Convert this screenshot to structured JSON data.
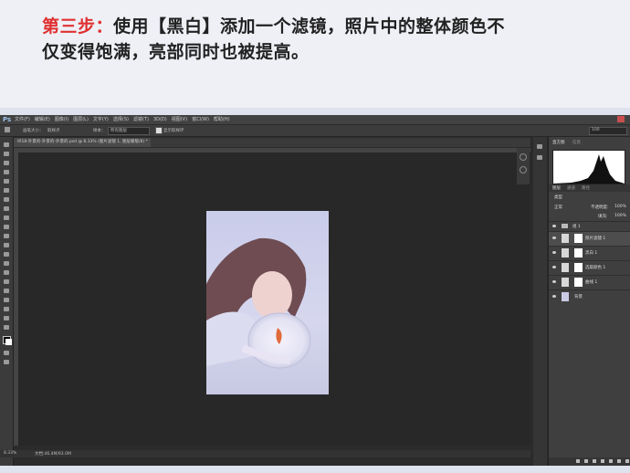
{
  "banner": {
    "step_label": "第三步：",
    "line1_rest": "使用【黑白】添加一个滤镜，照片中的整体颜色不",
    "line2": "仅变得饱满，亮部同时也被提高。"
  },
  "app": {
    "logo": "Ps",
    "menu": [
      "文件(F)",
      "编辑(E)",
      "图像(I)",
      "图层(L)",
      "文字(Y)",
      "选择(S)",
      "滤镜(T)",
      "3D(D)",
      "视图(V)",
      "窗口(W)",
      "帮助(H)"
    ],
    "accent_color": "#9dc4ef"
  },
  "options": {
    "size_label": "画笔大小：",
    "sample_label": "取样点",
    "sample_label2": "样本：",
    "sample_value": "所有图层",
    "show_ring": "显示取样环",
    "zoom_value": "100"
  },
  "document": {
    "tab_title": "IR18-外景的-外景的-外景的.psd @ 8.33% (图片滤镜 1, 图层蒙版/8) *"
  },
  "status": {
    "zoom": "8.33%",
    "doc_size": "文档:46.4M/93.0M"
  },
  "panels": {
    "histogram_tab": "直方图",
    "info_tab": "信息",
    "layers_tab": "图层",
    "channels_tab": "通道",
    "paths_tab": "路径",
    "kind_label": "类型",
    "blend_mode": "正常",
    "opacity_label": "不透明度:",
    "opacity_value": "100%",
    "fill_label": "填充:",
    "fill_value": "100%",
    "layers": [
      {
        "name": "组 1"
      },
      {
        "name": "照片滤镜 1"
      },
      {
        "name": "黑白 1"
      },
      {
        "name": "选取颜色 1"
      },
      {
        "name": "曲线 1"
      },
      {
        "name": "背景"
      }
    ]
  }
}
